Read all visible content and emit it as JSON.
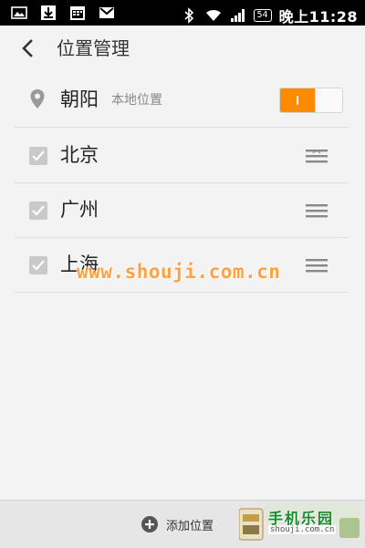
{
  "status_bar": {
    "left_icons": [
      "image-icon",
      "download-icon",
      "calendar-icon",
      "mail-icon"
    ],
    "right_icons": [
      "bluetooth-icon",
      "wifi-icon",
      "signal-icon"
    ],
    "battery": "54",
    "time": "晚上11:28"
  },
  "header": {
    "title": "位置管理",
    "back_icon": "chevron-left-icon"
  },
  "current_location": {
    "icon": "location-pin-icon",
    "name": "朝阳",
    "tag": "本地位置",
    "toggle_on": true
  },
  "cities": [
    {
      "name": "北京",
      "checked": true
    },
    {
      "name": "广州",
      "checked": true
    },
    {
      "name": "上海",
      "checked": true
    }
  ],
  "watermark": "www.shouji.com.cn",
  "bottom_bar": {
    "add_label": "添加位置",
    "add_icon": "plus-circle-icon"
  },
  "corner_logo": {
    "title": "手机乐园",
    "subtitle": "shouji.com.cn"
  },
  "colors": {
    "accent": "#ff8a00",
    "background": "#f3f3f3",
    "status_bar": "#000000",
    "checkbox": "#c9c9c9",
    "divider": "#dedede"
  }
}
